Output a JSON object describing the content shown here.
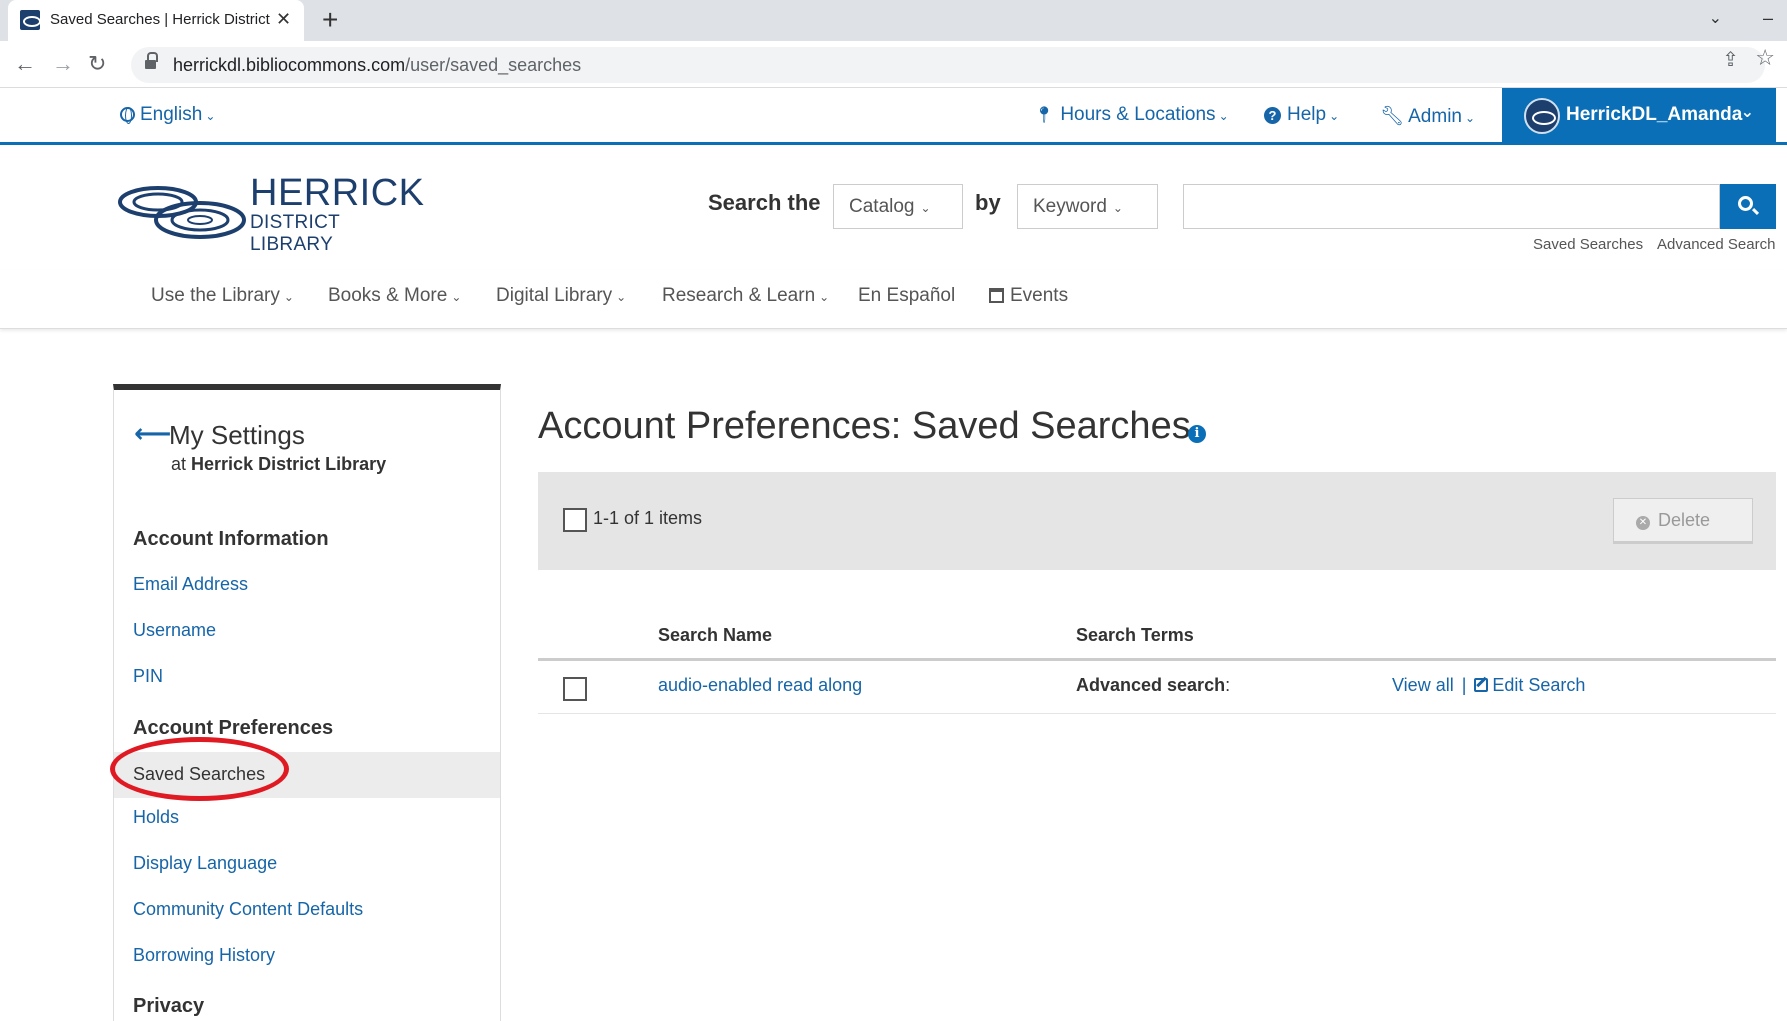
{
  "browser": {
    "tab_title": "Saved Searches | Herrick District Library",
    "url_host": "herrickdl.bibliocommons.com",
    "url_path": "/user/saved_searches"
  },
  "utility_bar": {
    "language": "English",
    "hours": "Hours & Locations",
    "help": "Help",
    "admin": "Admin",
    "user": "HerrickDL_Amanda"
  },
  "logo": {
    "main": "HERRICK",
    "sub": "DISTRICT LIBRARY"
  },
  "search": {
    "label": "Search the",
    "scope": "Catalog",
    "by_label": "by",
    "type": "Keyword",
    "query": "",
    "links": [
      "Saved Searches",
      "Advanced Search"
    ]
  },
  "nav": [
    "Use the Library",
    "Books & More",
    "Digital Library",
    "Research & Learn",
    "En Español",
    "Events"
  ],
  "sidebar": {
    "title": "My Settings",
    "sub_prefix": "at",
    "sub_library": "Herrick District Library",
    "account_info_heading": "Account Information",
    "account_info_links": [
      "Email Address",
      "Username",
      "PIN"
    ],
    "account_prefs_heading": "Account Preferences",
    "active_item": "Saved Searches",
    "account_prefs_links": [
      "Holds",
      "Display Language",
      "Community Content Defaults",
      "Borrowing History"
    ],
    "privacy_heading": "Privacy"
  },
  "main": {
    "title": "Account Preferences: Saved Searches",
    "items_count": "1-1 of 1 items",
    "delete_label": "Delete",
    "columns": [
      "Search Name",
      "Search Terms"
    ],
    "rows": [
      {
        "name": "audio-enabled read along",
        "terms": "Advanced search",
        "view_all": "View all",
        "edit": "Edit Search"
      }
    ]
  },
  "colors": {
    "brand_blue": "#0a6fb6",
    "link_blue": "#1665a8",
    "highlight_circle": "#e01a22"
  }
}
